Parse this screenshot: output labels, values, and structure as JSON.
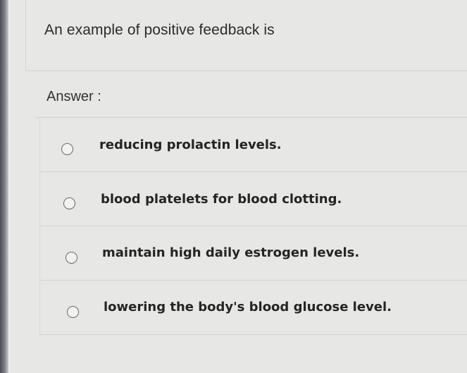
{
  "question": {
    "text": "An example of positive feedback is"
  },
  "answer": {
    "label": "Answer :"
  },
  "options": [
    {
      "label": "reducing prolactin levels.",
      "selected": false
    },
    {
      "label": "blood platelets for blood clotting.",
      "selected": false
    },
    {
      "label": "maintain high daily estrogen levels.",
      "selected": false
    },
    {
      "label": "lowering the body's blood glucose level.",
      "selected": false
    }
  ]
}
